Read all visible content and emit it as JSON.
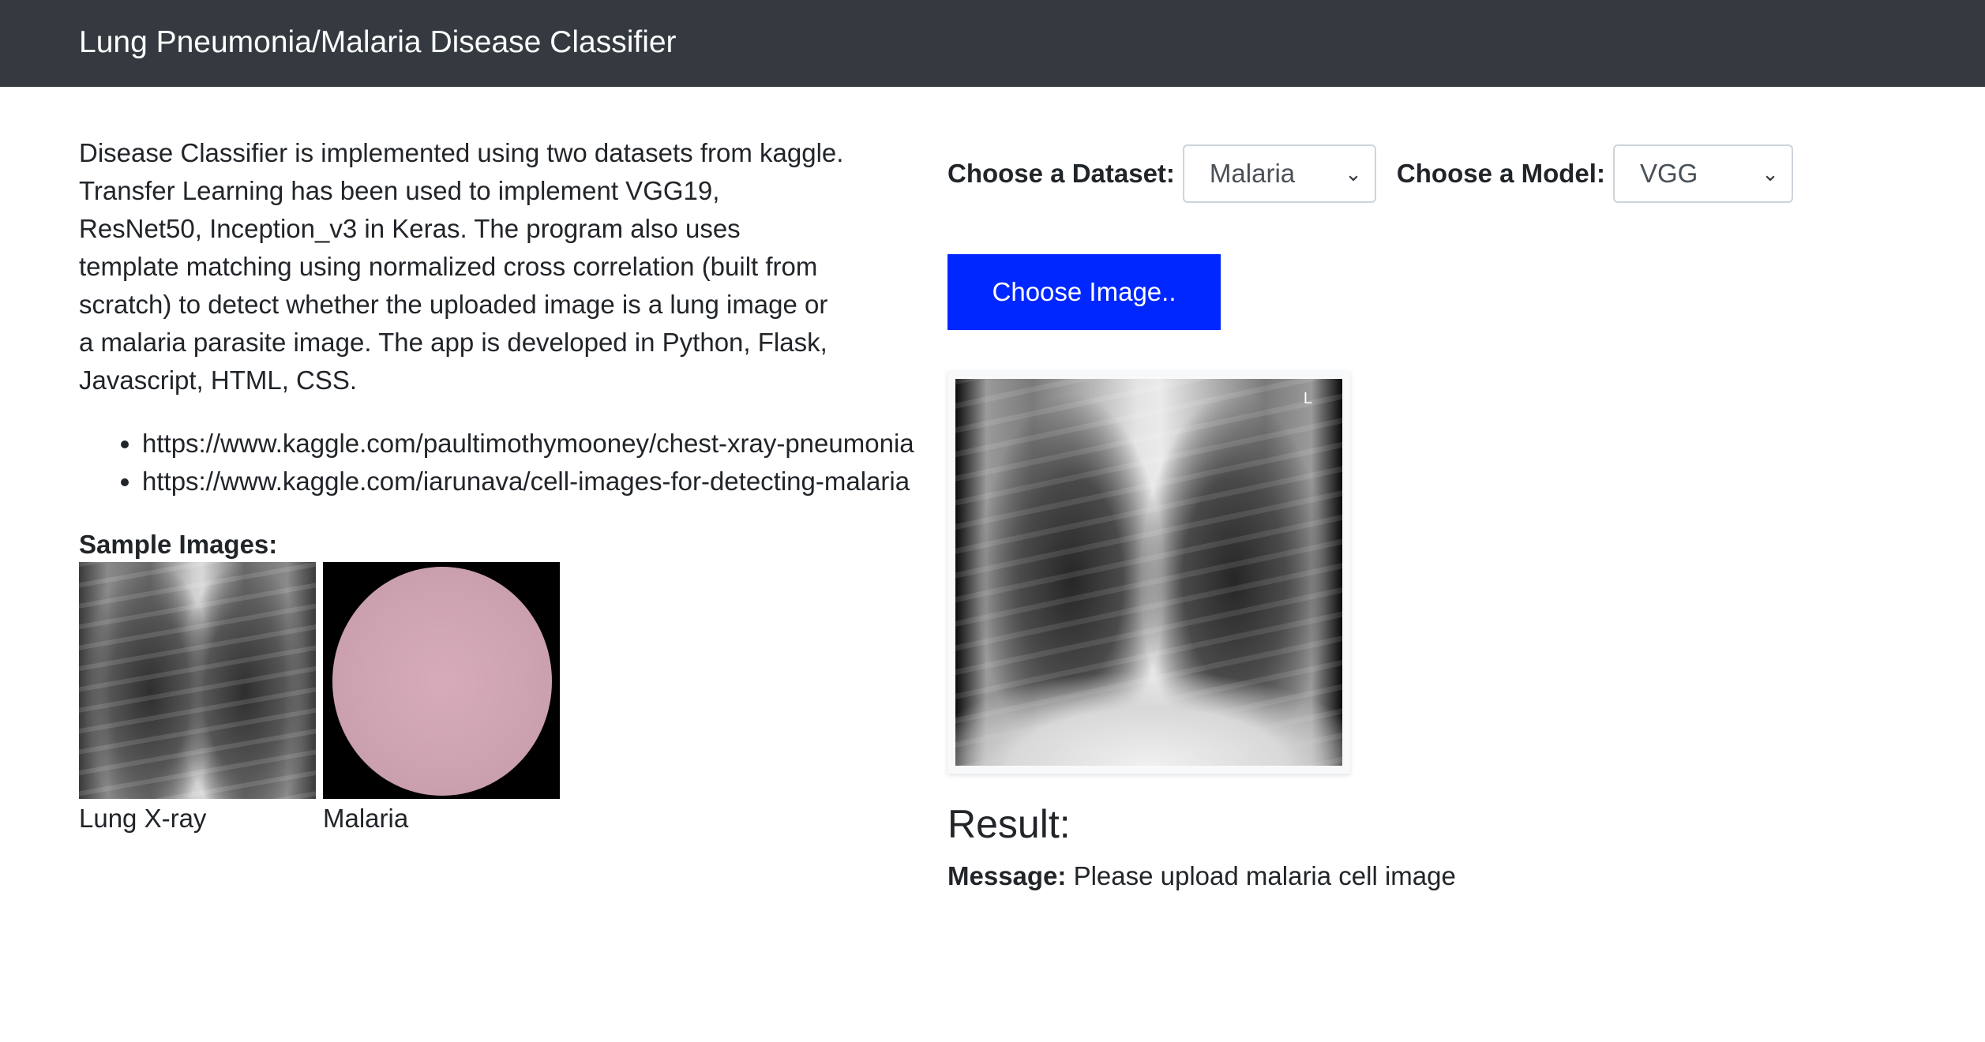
{
  "navbar": {
    "title": "Lung Pneumonia/Malaria Disease Classifier"
  },
  "left": {
    "description": "Disease Classifier is implemented using two datasets from kaggle. Transfer Learning has been used to implement VGG19, ResNet50, Inception_v3 in Keras. The program also uses template matching using normalized cross correlation (built from scratch) to detect whether the uploaded image is a lung image or a malaria parasite image. The app is developed in Python, Flask, Javascript, HTML, CSS.",
    "links": [
      "https://www.kaggle.com/paultimothymooney/chest-xray-pneumonia",
      "https://www.kaggle.com/iarunava/cell-images-for-detecting-malaria"
    ],
    "sample_title": "Sample Images:",
    "samples": [
      {
        "caption": "Lung X-ray"
      },
      {
        "caption": "Malaria"
      }
    ]
  },
  "right": {
    "dataset_label": "Choose a Dataset:",
    "dataset_value": "Malaria",
    "model_label": "Choose a Model:",
    "model_value": "VGG",
    "choose_button": "Choose Image..",
    "preview_marker": "L",
    "result_title": "Result:",
    "message_label": "Message:",
    "message_text": "Please upload malaria cell image"
  },
  "colors": {
    "navbar_bg": "#343a40",
    "button_bg": "#0027ff",
    "text": "#212529"
  },
  "icons": [
    "chevron-down-icon"
  ]
}
